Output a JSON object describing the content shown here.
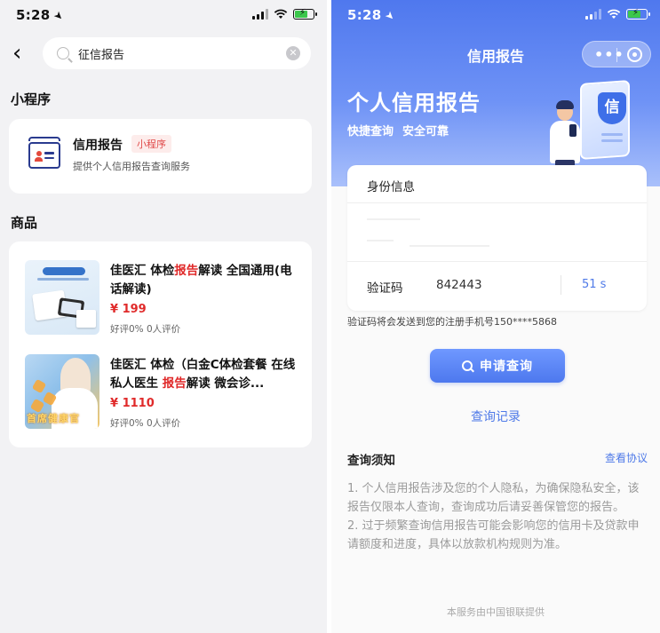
{
  "left": {
    "status": {
      "time": "5:28"
    },
    "search": {
      "query": "征信报告"
    },
    "mini_program_section": {
      "title": "小程序",
      "item": {
        "name": "信用报告",
        "tag": "小程序",
        "desc": "提供个人信用报告查询服务"
      }
    },
    "goods_section": {
      "title": "商品",
      "items": [
        {
          "title_before": "佳医汇 体检",
          "title_highlight": "报告",
          "title_after": "解读 全国通用(电话解读)",
          "price": "¥ 199",
          "reviews": "好评0% 0人评价"
        },
        {
          "title_before": "佳医汇 体检（白金C体检套餐 在线私人医生 ",
          "title_highlight": "报告",
          "title_after": "解读 微会诊...",
          "price": "¥ 1110",
          "reviews": "好评0% 0人评价",
          "thumb_label": "首席健康官"
        }
      ]
    }
  },
  "right": {
    "status": {
      "time": "5:28"
    },
    "nav": {
      "title": "信用报告",
      "more_icon": "more-dots-icon",
      "close_icon": "close-circle-icon"
    },
    "hero": {
      "title": "个人信用报告",
      "sub1": "快捷查询",
      "sub2": "安全可靠",
      "shield_char": "信"
    },
    "form": {
      "title": "身份信息",
      "verify_label": "验证码",
      "verify_code": "842443",
      "timer": "51 s"
    },
    "hint": "验证码将会发送到您的注册手机号150****5868",
    "query_button": "申请查询",
    "record_link": "查询记录",
    "notice": {
      "title": "查询须知",
      "link": "查看协议",
      "items": [
        "1. 个人信用报告涉及您的个人隐私，为确保隐私安全，该报告仅限本人查询，查询成功后请妥善保管您的报告。",
        "2. 过于频繁查询信用报告可能会影响您的信用卡及贷款申请额度和进度，具体以放款机构规则为准。"
      ]
    },
    "footer": "本服务由中国银联提供"
  },
  "colors": {
    "accent_blue": "#4f7ae8",
    "price_red": "#e02a2a",
    "tag_red": "#e04b4b",
    "hero_gradient_top": "#4f78ee"
  }
}
